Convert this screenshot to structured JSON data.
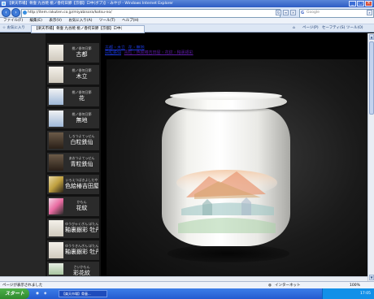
{
  "window": {
    "title": "【楽天市場】骨壷 九谷焼 桃ノ香何日節【京都】ロ中(ボブ)】- みやび - Windows Internet Explorer",
    "controls": {
      "minimize": "_",
      "maximize": "□",
      "close": "×"
    }
  },
  "addressbar": {
    "url": "http://item.rakuten.co.jp/miyabisora/kotsu-no/",
    "search_placeholder": "Google",
    "search_logo": "G"
  },
  "menubar": {
    "items": [
      "ファイル(F)",
      "編集(E)",
      "表示(V)",
      "お気に入り(A)",
      "ツール(T)",
      "ヘルプ(H)"
    ]
  },
  "tabbar": {
    "favorites": "お気に入り",
    "tab_label": "【楽天市場】骨壷 九谷焼 桃ノ香何日節【京都】ロ中(",
    "commands": [
      "ページ(P)",
      "セーフティ(S)",
      "ツール(O)"
    ]
  },
  "sidebar": {
    "items": [
      {
        "sub": "桃ノ香何日節",
        "name": "古都",
        "thumb": "plain"
      },
      {
        "sub": "桃ノ香何日節",
        "name": "木立",
        "thumb": "plain"
      },
      {
        "sub": "桃ノ香何日節",
        "name": "花",
        "thumb": "blue"
      },
      {
        "sub": "桃ノ香何日節",
        "name": "無地",
        "thumb": "blue"
      },
      {
        "sub": "しろつよてっせん",
        "name": "白粒鉄仙",
        "thumb": "dark"
      },
      {
        "sub": "あおつよてっせん",
        "name": "青粒鉄仙",
        "thumb": "dark"
      },
      {
        "sub": "いろえつばきよしだや",
        "name": "色絵椿吉田屋",
        "thumb": "gold"
      },
      {
        "sub": "かもん",
        "name": "花紋",
        "thumb": "flower"
      },
      {
        "sub": "ゆうびゃくぎん ぼたん",
        "name": "釉裏銀彩 牡丹",
        "thumb": "plain"
      },
      {
        "sub": "ゆうりきんぎん ぼたん",
        "name": "釉裏銀彩 牡丹",
        "thumb": "plain"
      },
      {
        "sub": "さいかもん",
        "name": "彩花紋",
        "thumb": "green"
      }
    ]
  },
  "page_links": {
    "row1": [
      "古都・木立",
      "花・無地"
    ],
    "row2": [
      "白粒鉄仙",
      "青粒・色絵椿吉田屋・花紋・釉裏銀彩"
    ]
  },
  "statusbar": {
    "message": "ページが表示されました",
    "zone": "インターネット",
    "zoom": "100%"
  },
  "taskbar": {
    "start_label": "スタート",
    "task_item": "【楽天市場】骨壷...",
    "clock": "17:05"
  }
}
